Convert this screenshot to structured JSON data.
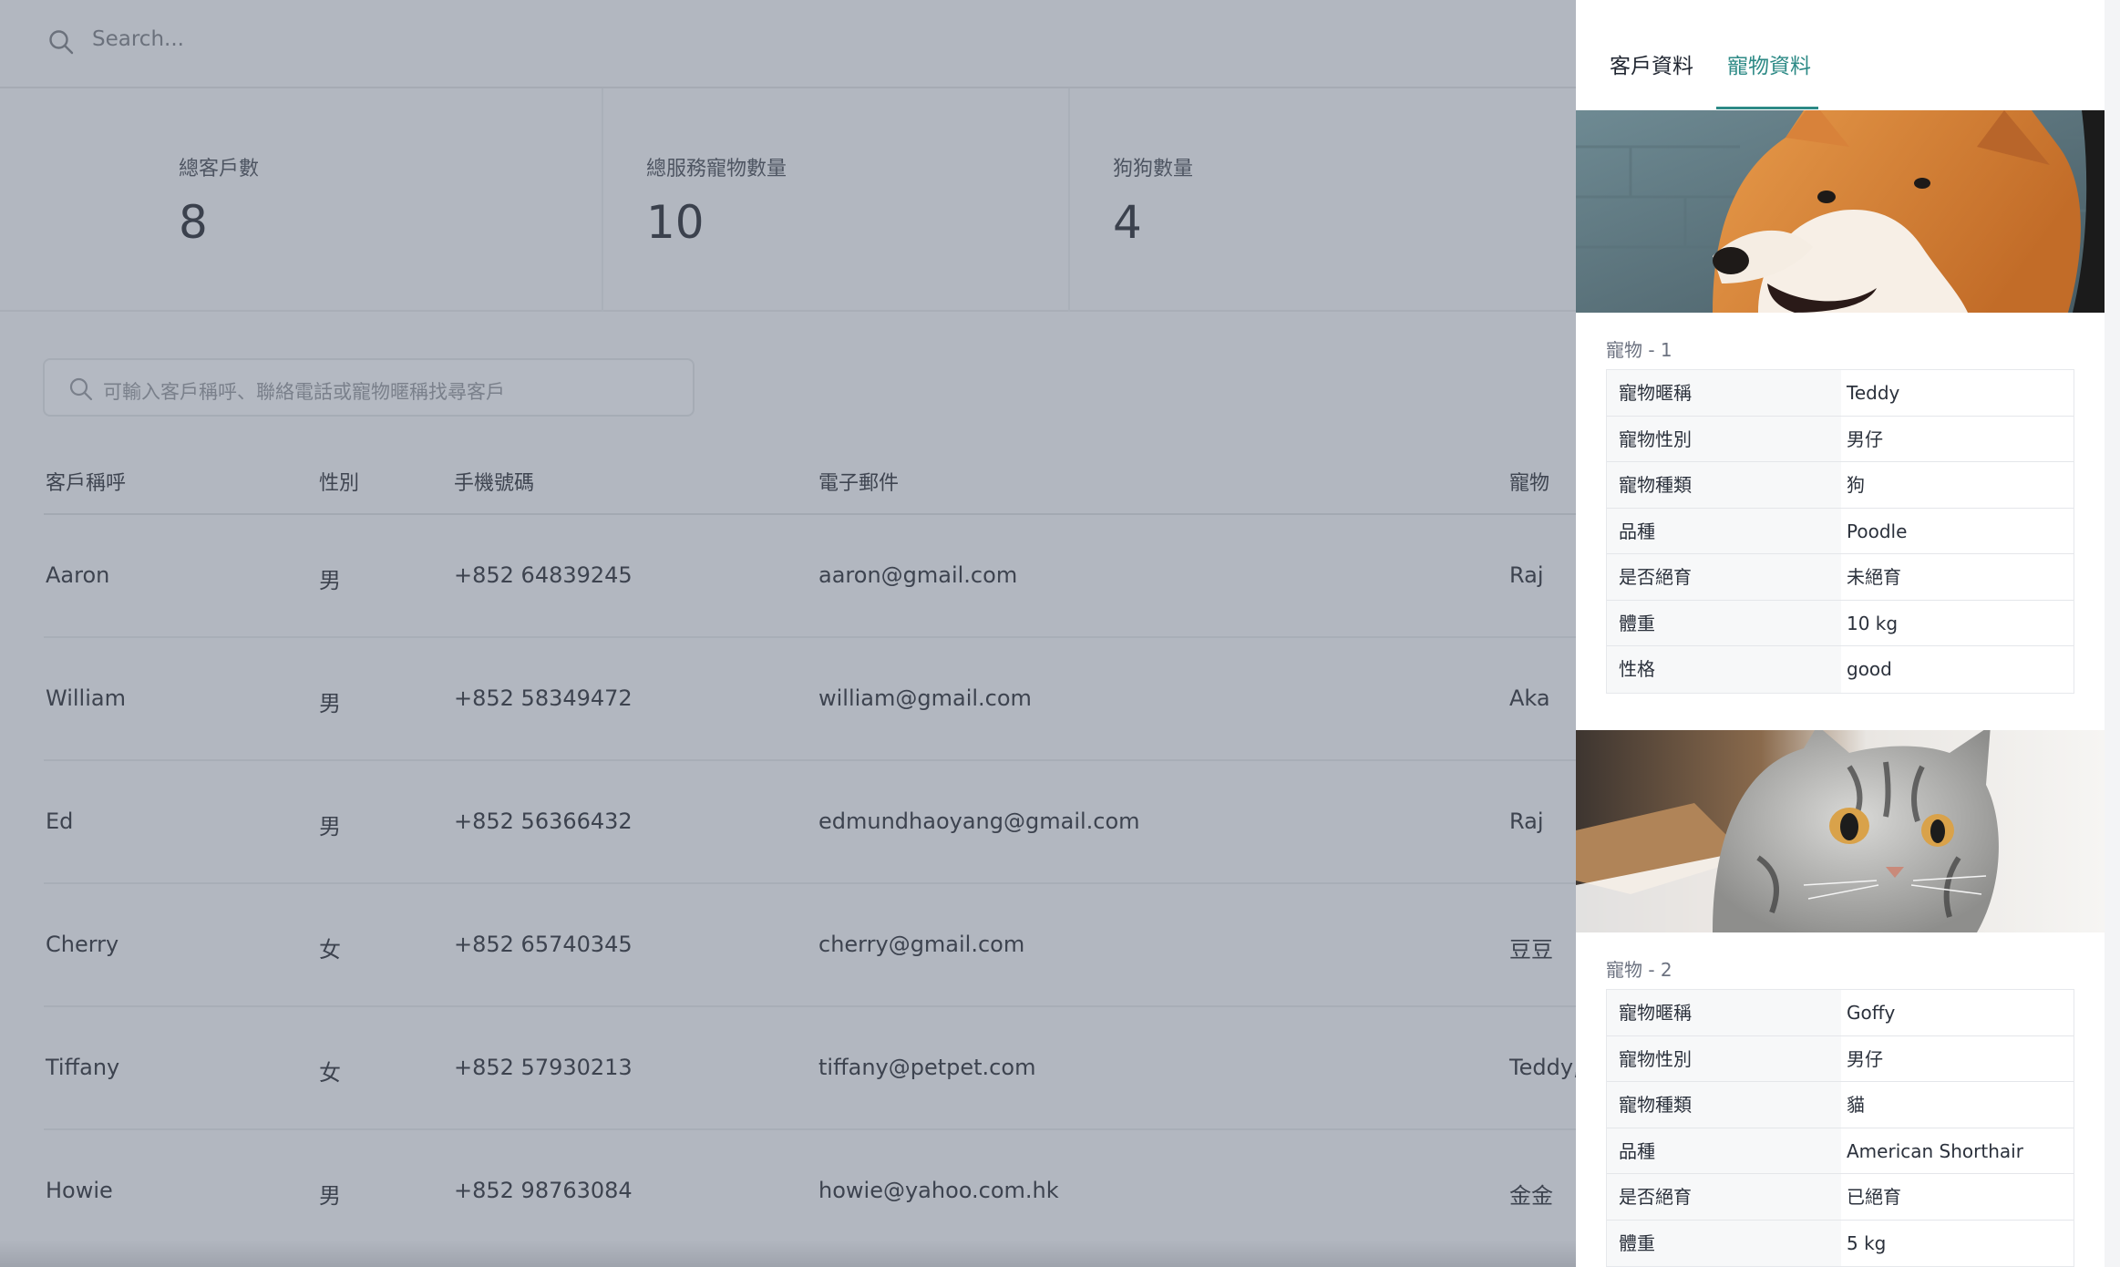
{
  "topbar": {
    "search_placeholder": "Search..."
  },
  "stats": [
    {
      "label": "總客戶數",
      "value": "8"
    },
    {
      "label": "總服務寵物數量",
      "value": "10"
    },
    {
      "label": "狗狗數量",
      "value": "4"
    }
  ],
  "filter": {
    "placeholder": "可輸入客戶稱呼、聯絡電話或寵物暱稱找尋客戶"
  },
  "table": {
    "headers": [
      "客戶稱呼",
      "性別",
      "手機號碼",
      "電子郵件",
      "寵物"
    ],
    "rows": [
      [
        "Aaron",
        "男",
        "+852 64839245",
        "aaron@gmail.com",
        "Raj"
      ],
      [
        "William",
        "男",
        "+852 58349472",
        "william@gmail.com",
        "Aka"
      ],
      [
        "Ed",
        "男",
        "+852 56366432",
        "edmundhaoyang@gmail.com",
        "Raj"
      ],
      [
        "Cherry",
        "女",
        "+852 65740345",
        "cherry@gmail.com",
        "豆豆"
      ],
      [
        "Tiffany",
        "女",
        "+852 57930213",
        "tiffany@petpet.com",
        "Teddy,"
      ],
      [
        "Howie",
        "男",
        "+852 98763084",
        "howie@yahoo.com.hk",
        "金金"
      ]
    ]
  },
  "drawer": {
    "tabs": [
      {
        "label": "客戶資料",
        "active": false
      },
      {
        "label": "寵物資料",
        "active": true
      }
    ],
    "accent": "#2d8a86",
    "pets": [
      {
        "section_label": "寵物 - 1",
        "image": "shiba-dog-photo",
        "fields": [
          {
            "key": "寵物暱稱",
            "value": "Teddy"
          },
          {
            "key": "寵物性別",
            "value": "男仔"
          },
          {
            "key": "寵物種類",
            "value": "狗"
          },
          {
            "key": "品種",
            "value": "Poodle"
          },
          {
            "key": "是否絕育",
            "value": "未絕育"
          },
          {
            "key": "體重",
            "value": "10 kg"
          },
          {
            "key": "性格",
            "value": "good"
          }
        ]
      },
      {
        "section_label": "寵物 - 2",
        "image": "tabby-cat-photo",
        "fields": [
          {
            "key": "寵物暱稱",
            "value": "Goffy"
          },
          {
            "key": "寵物性別",
            "value": "男仔"
          },
          {
            "key": "寵物種類",
            "value": "貓"
          },
          {
            "key": "品種",
            "value": "American Shorthair"
          },
          {
            "key": "是否絕育",
            "value": "已絕育"
          },
          {
            "key": "體重",
            "value": "5 kg"
          }
        ]
      }
    ]
  }
}
